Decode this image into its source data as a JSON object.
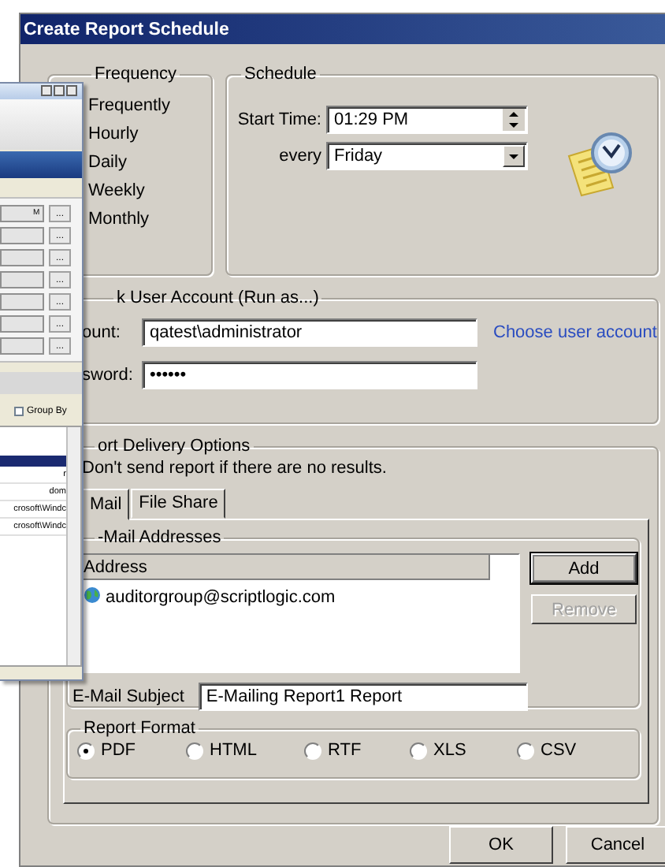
{
  "window": {
    "title": "Create Report Schedule"
  },
  "frequency": {
    "legend": "Frequency",
    "options": [
      {
        "label": "Frequently"
      },
      {
        "label": "Hourly"
      },
      {
        "label": "Daily"
      },
      {
        "label": "Weekly"
      },
      {
        "label": "Monthly"
      }
    ]
  },
  "schedule": {
    "legend": "Schedule",
    "start_time_label": "Start Time:",
    "start_time": "01:29 PM",
    "every_label": "every",
    "every": "Friday"
  },
  "run_as": {
    "legend": "k User Account (Run as...)",
    "account_label": "ount:",
    "account": "qatest\\administrator",
    "password_label": "sword:",
    "password": "••••••",
    "link": "Choose user account"
  },
  "delivery": {
    "legend": "ort Delivery Options",
    "no_results_text": "Don't send report if there are no results.",
    "tabs": [
      {
        "label": "Mail",
        "selected": true
      },
      {
        "label": "File Share",
        "selected": false
      }
    ],
    "addresses": {
      "legend": "-Mail Addresses",
      "column": "Address",
      "rows": [
        "auditorgroup@scriptlogic.com"
      ],
      "buttons": [
        {
          "label": "Add",
          "disabled": false
        },
        {
          "label": "Remove",
          "disabled": true
        }
      ]
    },
    "subject_label": "E-Mail Subject",
    "subject": "E-Mailing Report1 Report",
    "format": {
      "legend": "Report Format",
      "options": [
        {
          "label": "PDF",
          "selected": true
        },
        {
          "label": "HTML",
          "selected": false
        },
        {
          "label": "RTF",
          "selected": false
        },
        {
          "label": "XLS",
          "selected": false
        },
        {
          "label": "CSV",
          "selected": false
        }
      ]
    }
  },
  "buttons": [
    "OK",
    "Cancel"
  ],
  "back_window": {
    "first_field": "M",
    "browse_buttons": [
      "...",
      "...",
      "...",
      "...",
      "...",
      "...",
      "..."
    ],
    "group_by": {
      "label": "Group By",
      "checked": false
    },
    "rows": [
      "r",
      "dom",
      "crosoft\\Windc",
      "crosoft\\Windc"
    ]
  }
}
